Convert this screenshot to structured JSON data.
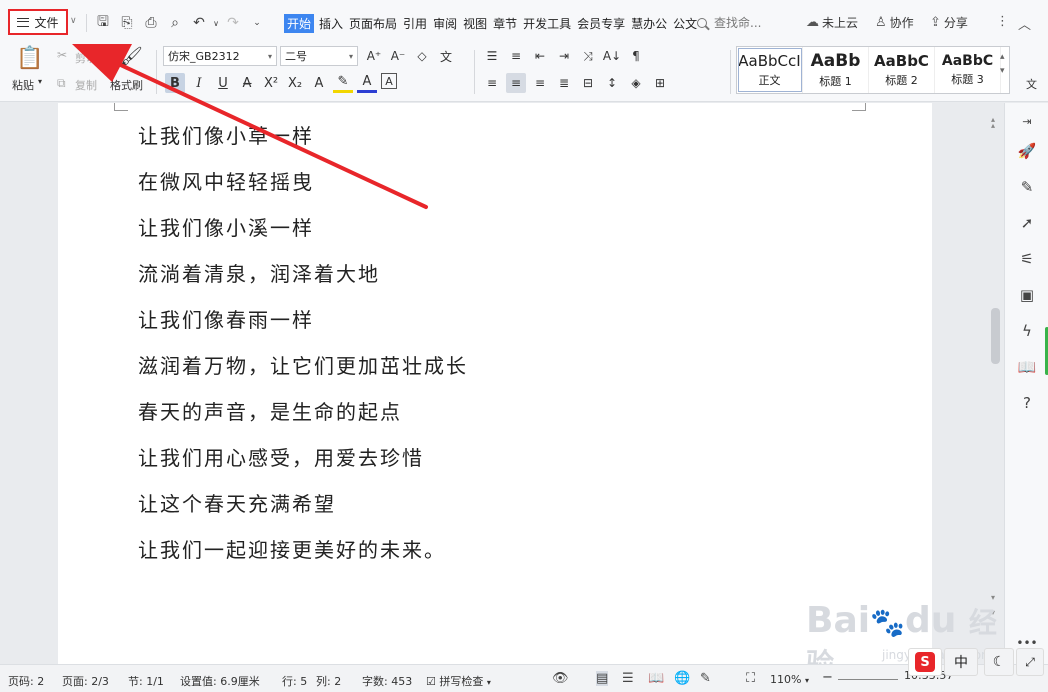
{
  "menubar": {
    "file_label": "文件",
    "tabs": [
      "开始",
      "插入",
      "页面布局",
      "引用",
      "审阅",
      "视图",
      "章节",
      "开发工具",
      "会员专享",
      "慧办公",
      "公文"
    ],
    "active_tab": "开始",
    "search_placeholder": "查找命...",
    "cloud_label": "未上云",
    "collab_label": "协作",
    "share_label": "分享"
  },
  "ribbon": {
    "paste_label": "粘贴",
    "cut_label": "剪切",
    "copy_label": "复制",
    "format_painter_label": "格式刷",
    "font_name": "仿宋_GB2312",
    "font_size": "二号",
    "styles": [
      {
        "sample": "AaBbCcI",
        "name": "正文"
      },
      {
        "sample": "AaBb",
        "name": "标题 1"
      },
      {
        "sample": "AaBbC",
        "name": "标题 2"
      },
      {
        "sample": "AaBbC",
        "name": "标题 3"
      }
    ],
    "more_label": "文"
  },
  "document": {
    "lines": [
      "让我们像小草一样",
      "在微风中轻轻摇曳",
      "让我们像小溪一样",
      "流淌着清泉，润泽着大地",
      "让我们像春雨一样",
      "滋润着万物，让它们更加茁壮成长",
      "春天的声音，是生命的起点",
      "让我们用心感受，用爱去珍惜",
      "让这个春天充满希望",
      "让我们一起迎接更美好的未来。"
    ]
  },
  "statusbar": {
    "page": "页码: 2",
    "pages": "页面: 2/3",
    "section": "节: 1/1",
    "setting": "设置值: 6.9厘米",
    "row": "行: 5",
    "col": "列: 2",
    "wordcount": "字数: 453",
    "spellcheck": "拼写检查",
    "zoom": "110%",
    "ime_label": "中",
    "time": "10:33:57"
  },
  "watermark": {
    "brand": "Bai",
    "brand2": "du",
    "brand3": "经验",
    "url": "jingyan.baidu.com"
  },
  "colors": {
    "accent": "#3d86f0",
    "highlight_box": "#e8262a",
    "arrow": "#e8262a",
    "green": "#38b34a"
  }
}
